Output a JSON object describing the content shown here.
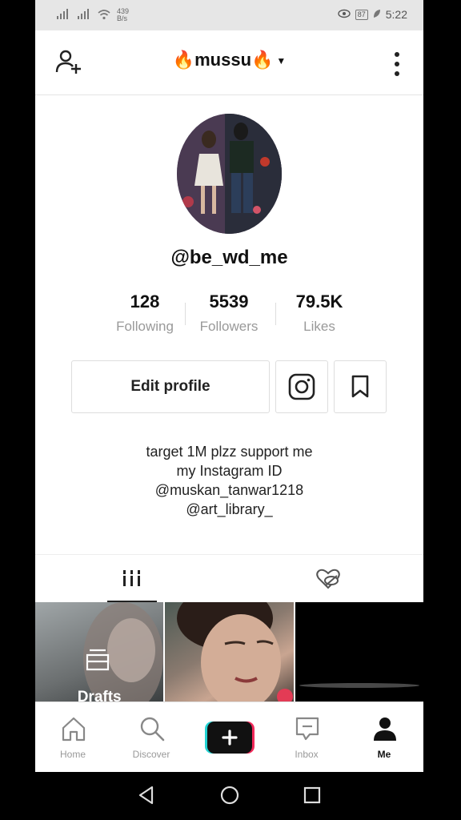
{
  "status_bar": {
    "net_speed_value": "439",
    "net_speed_unit": "B/s",
    "battery": "87",
    "time": "5:22"
  },
  "header": {
    "title": "mussu"
  },
  "profile": {
    "handle": "@be_wd_me",
    "stats": [
      {
        "value": "128",
        "label": "Following"
      },
      {
        "value": "5539",
        "label": "Followers"
      },
      {
        "value": "79.5K",
        "label": "Likes"
      }
    ],
    "edit_label": "Edit profile",
    "bio": [
      "target 1M plzz support me",
      "my Instagram ID",
      "@muskan_tanwar1218",
      "@art_library_"
    ]
  },
  "grid": {
    "drafts_label": "Drafts"
  },
  "nav": {
    "home": "Home",
    "discover": "Discover",
    "inbox": "Inbox",
    "me": "Me"
  }
}
